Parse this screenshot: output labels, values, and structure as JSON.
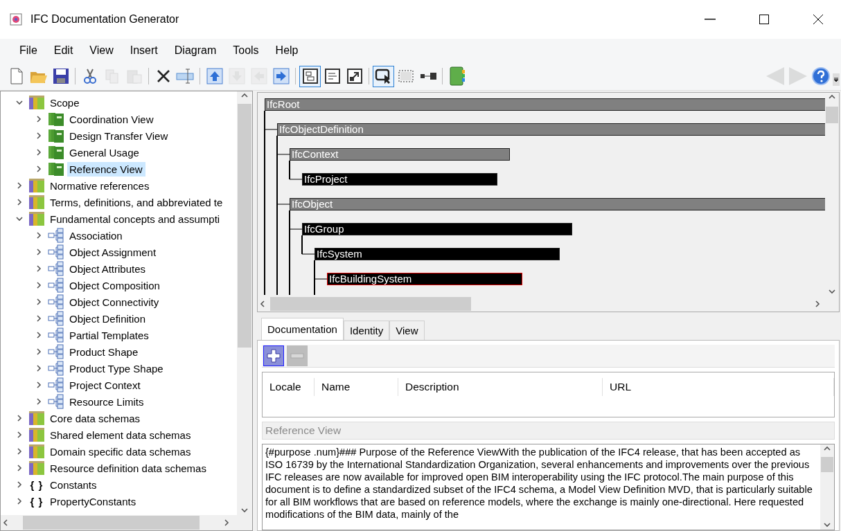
{
  "window": {
    "title": "IFC Documentation Generator"
  },
  "menu": [
    "File",
    "Edit",
    "View",
    "Insert",
    "Diagram",
    "Tools",
    "Help"
  ],
  "toolbar": {
    "groups": [
      [
        {
          "disabled": false
        },
        {
          "disabled": false
        },
        {
          "disabled": false
        }
      ],
      [
        {
          "disabled": false
        },
        {
          "disabled": true
        },
        {
          "disabled": true
        }
      ],
      [
        {
          "disabled": false
        },
        {
          "disabled": false
        }
      ],
      [
        {
          "disabled": false
        },
        {
          "disabled": true
        },
        {
          "disabled": true
        },
        {
          "disabled": false
        }
      ],
      [
        {
          "disabled": false,
          "selected": true
        },
        {
          "disabled": false,
          "selected": false
        },
        {
          "disabled": false,
          "selected": false
        }
      ],
      [
        {
          "disabled": false,
          "selected": true
        },
        {
          "disabled": false,
          "selected": false
        },
        {
          "disabled": false,
          "selected": false
        }
      ],
      [
        {
          "disabled": false
        }
      ]
    ],
    "navigation": [
      {
        "disabled": true
      },
      {
        "disabled": true
      },
      {
        "disabled": false
      }
    ]
  },
  "tree": [
    {
      "label": "Scope",
      "kind": "book-stack",
      "expanded": true,
      "selected": false,
      "children": [
        {
          "label": "Coordination View",
          "kind": "view",
          "expanded": false,
          "selected": false
        },
        {
          "label": "Design Transfer View",
          "kind": "view",
          "expanded": false,
          "selected": false
        },
        {
          "label": "General Usage",
          "kind": "view",
          "expanded": false,
          "selected": false
        },
        {
          "label": "Reference View",
          "kind": "view",
          "expanded": false,
          "selected": true
        }
      ]
    },
    {
      "label": "Normative references",
      "kind": "book-stack",
      "expanded": false,
      "selected": false
    },
    {
      "label": "Terms, definitions, and abbreviated te",
      "kind": "book-stack",
      "expanded": false,
      "selected": false
    },
    {
      "label": "Fundamental concepts and assumpti",
      "kind": "book-stack",
      "expanded": true,
      "selected": false,
      "children": [
        {
          "label": "Association",
          "kind": "concept",
          "expanded": false,
          "selected": false
        },
        {
          "label": "Object Assignment",
          "kind": "concept",
          "expanded": false,
          "selected": false
        },
        {
          "label": "Object Attributes",
          "kind": "concept",
          "expanded": false,
          "selected": false
        },
        {
          "label": "Object Composition",
          "kind": "concept",
          "expanded": false,
          "selected": false
        },
        {
          "label": "Object Connectivity",
          "kind": "concept",
          "expanded": false,
          "selected": false
        },
        {
          "label": "Object Definition",
          "kind": "concept",
          "expanded": false,
          "selected": false
        },
        {
          "label": "Partial Templates",
          "kind": "concept",
          "expanded": false,
          "selected": false
        },
        {
          "label": "Product Shape",
          "kind": "concept",
          "expanded": false,
          "selected": false
        },
        {
          "label": "Product Type Shape",
          "kind": "concept",
          "expanded": false,
          "selected": false
        },
        {
          "label": "Project Context",
          "kind": "concept",
          "expanded": false,
          "selected": false
        },
        {
          "label": "Resource Limits",
          "kind": "concept",
          "expanded": false,
          "selected": false
        }
      ]
    },
    {
      "label": "Core data schemas",
      "kind": "book-stack",
      "expanded": false,
      "selected": false
    },
    {
      "label": "Shared element data schemas",
      "kind": "book-stack",
      "expanded": false,
      "selected": false
    },
    {
      "label": "Domain specific data schemas",
      "kind": "book-stack",
      "expanded": false,
      "selected": false
    },
    {
      "label": "Resource definition data schemas",
      "kind": "book-stack",
      "expanded": false,
      "selected": false
    },
    {
      "label": "Constants",
      "kind": "braces",
      "glyph": "{ }",
      "expanded": false,
      "selected": false
    },
    {
      "label": "PropertyConstants",
      "kind": "braces",
      "glyph": "{ }",
      "expanded": false,
      "selected": false
    }
  ],
  "diagram": {
    "nodes": [
      {
        "label": "IfcRoot",
        "kind": "abstract",
        "selected": false,
        "continues": true,
        "children": [
          {
            "label": "IfcObjectDefinition",
            "kind": "abstract",
            "selected": false,
            "continues": true,
            "children": [
              {
                "label": "IfcContext",
                "kind": "abstract",
                "selected": false,
                "continues": false,
                "children": [
                  {
                    "label": "IfcProject",
                    "kind": "concrete",
                    "selected": false,
                    "continues": false
                  }
                ]
              },
              {
                "label": "IfcObject",
                "kind": "abstract",
                "selected": false,
                "continues": true,
                "children": [
                  {
                    "label": "IfcGroup",
                    "kind": "concrete",
                    "selected": false,
                    "continues": false,
                    "children": [
                      {
                        "label": "IfcSystem",
                        "kind": "concrete",
                        "selected": false,
                        "continues": true,
                        "children": [
                          {
                            "label": "IfcBuildingSystem",
                            "kind": "concrete",
                            "selected": true,
                            "continues": false
                          }
                        ]
                      }
                    ]
                  }
                ]
              }
            ]
          }
        ]
      }
    ]
  },
  "details": {
    "tabs": [
      {
        "label": "Documentation",
        "selected": true
      },
      {
        "label": "Identity",
        "selected": false
      },
      {
        "label": "View",
        "selected": false
      }
    ],
    "actions": [
      {
        "kind": "add",
        "disabled": false,
        "checked": true
      },
      {
        "kind": "remove",
        "disabled": true,
        "checked": false
      }
    ],
    "table": {
      "columns": [
        "Locale",
        "Name",
        "Description",
        "URL"
      ]
    },
    "section_title": "Reference View",
    "text": "{#purpose .num}### Purpose of the Reference ViewWith the publication of the IFC4 release, that has been accepted as ISO 16739 by the International Standardization Organization, several enhancements and improvements over the previous IFC releases are now available for improved open BIM interoperability using the IFC protocol.The main purpose of this document is to define a standardized subset of the IFC4 schema, a Model View Definition MVD, that is particularly suitable for all BIM workflows that are based on reference models, where the exchange is mainly one-directional. Here requested modifications of the BIM data, mainly of the"
  }
}
